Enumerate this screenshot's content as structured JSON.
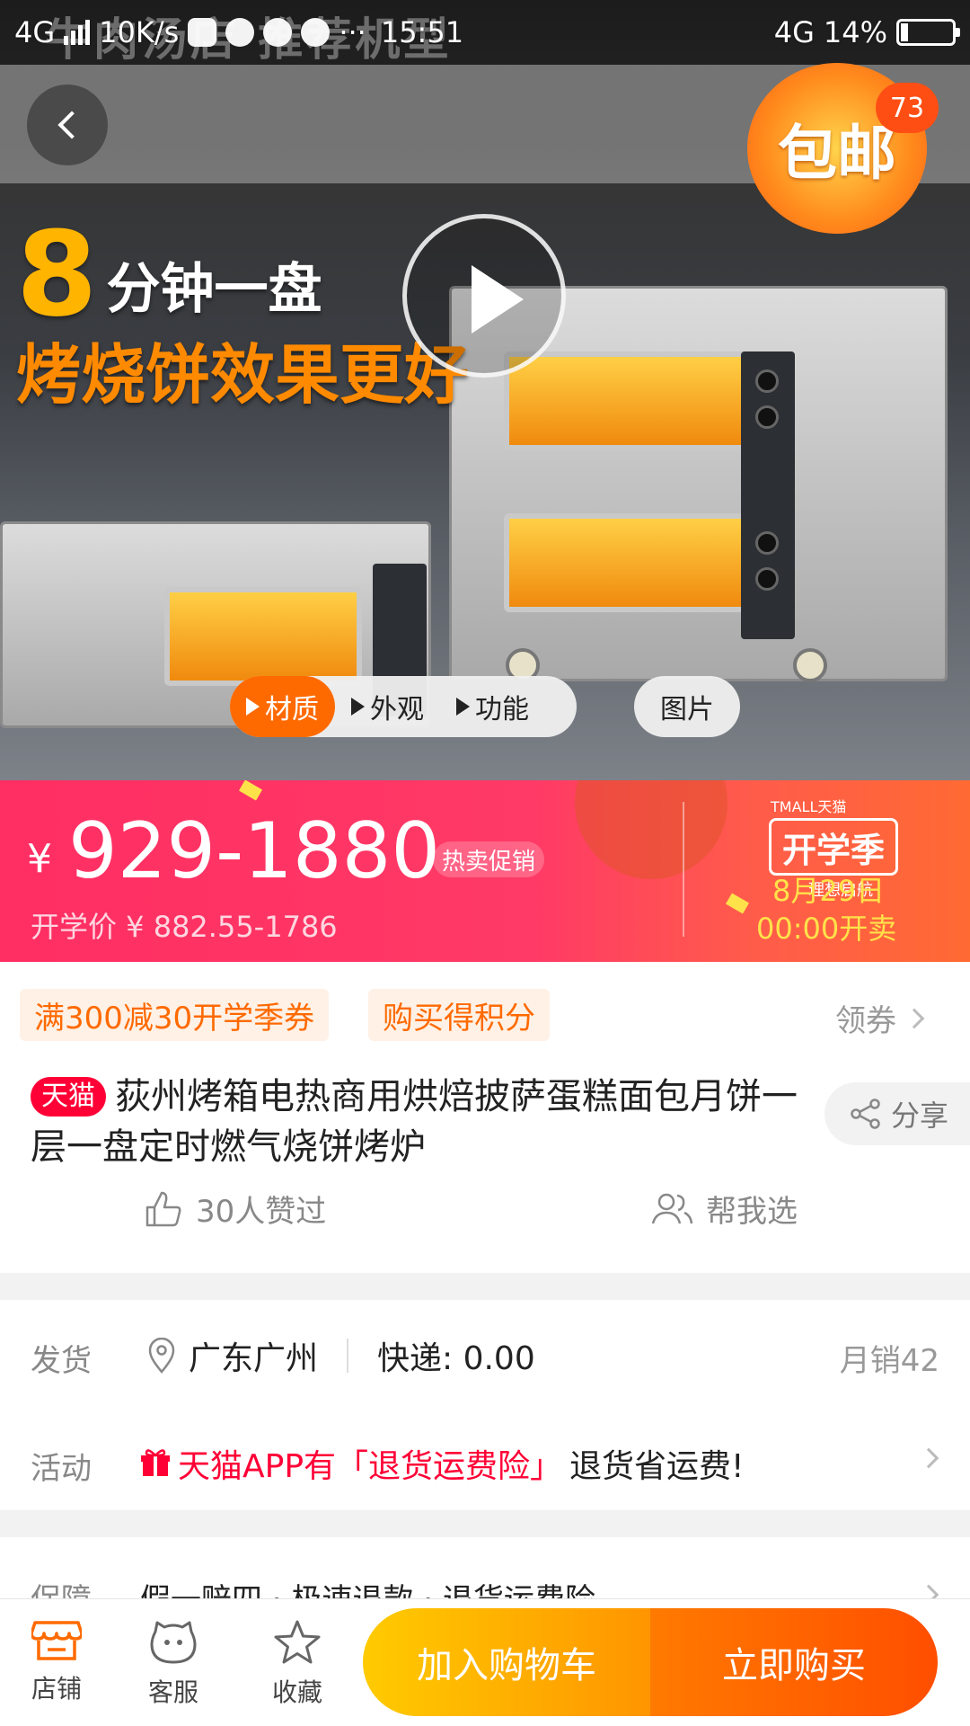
{
  "status_bar": {
    "network_left": "4G",
    "speed": "10K/s",
    "time": "15:51",
    "network_right": "4G",
    "battery": "14%"
  },
  "hero": {
    "watermark": "牛肉汤店 推荐机型",
    "free_shipping": "包邮",
    "cart_count": "73",
    "promo_number": "8",
    "promo_line1": "分钟一盘",
    "promo_line2": "烤烧饼效果更好",
    "media_tabs": [
      "材质",
      "外观",
      "功能"
    ],
    "image_tab": "图片"
  },
  "price": {
    "currency": "¥",
    "range": "929-1880",
    "tag": "热卖促销",
    "sub": "开学价 ¥ 882.55-1786"
  },
  "event": {
    "brand": "TMALL天猫",
    "name": "开学季",
    "slogan": "理想启航",
    "date": "8月29日",
    "time": "00:00开卖"
  },
  "coupons": {
    "items": [
      "满300减30开学季券",
      "购买得积分"
    ],
    "get_label": "领券"
  },
  "product": {
    "tag": "天猫",
    "title": "荻州烤箱电热商用烘焙披萨蛋糕面包月饼一层一盘定时燃气烧饼烤炉",
    "share_label": "分享",
    "likes": "30人赞过",
    "help_choose": "帮我选"
  },
  "shipping": {
    "label": "发货",
    "location": "广东广州",
    "express": "快递: 0.00",
    "monthly_sales": "月销42",
    "activity_label": "活动",
    "activity_red": "天猫APP有「退货运费险」",
    "activity_tail": "退货省运费!"
  },
  "guarantee": {
    "label": "保障",
    "text": "假一赔四 · 极速退款 · 退货运费险"
  },
  "bottom_bar": {
    "store": "店铺",
    "service": "客服",
    "favorite": "收藏",
    "add_cart": "加入购物车",
    "buy_now": "立即购买"
  },
  "colors": {
    "accent": "#ff6a00",
    "tmall_red": "#ff0036",
    "banner_pink": "#ff2e63"
  }
}
